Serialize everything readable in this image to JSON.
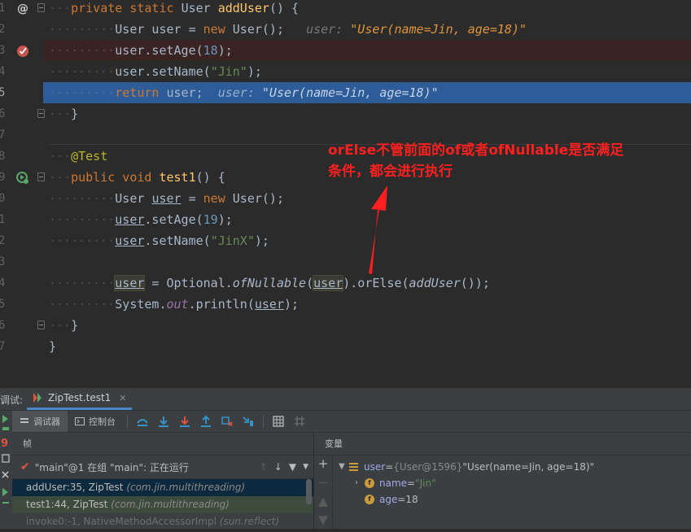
{
  "editor": {
    "lines": [
      {
        "num": "1",
        "gutter": "override-at-icon",
        "fold": true
      },
      {
        "num": "2"
      },
      {
        "num": "3",
        "gutter": "breakpoint-check-icon"
      },
      {
        "num": "4"
      },
      {
        "num": "5",
        "current": true
      },
      {
        "num": "6",
        "fold": true
      },
      {
        "num": "7"
      },
      {
        "num": "8"
      },
      {
        "num": "9",
        "gutter": "run-test-icon",
        "fold": true
      },
      {
        "num": "0"
      },
      {
        "num": "1"
      },
      {
        "num": "2"
      },
      {
        "num": "3"
      },
      {
        "num": "4"
      },
      {
        "num": "5"
      },
      {
        "num": "6",
        "fold": true
      },
      {
        "num": "7"
      }
    ],
    "code": {
      "l1_kw": "private static ",
      "l1_type": "User ",
      "l1_method": "addUser",
      "l1_rest": "() {",
      "l2_a": "User user = ",
      "l2_new": "new ",
      "l2_b": "User();",
      "l2_hint_label": "user: ",
      "l2_hint_value": "\"User(name=Jin, age=18)\"",
      "l3_a": "user.setAge(",
      "l3_num": "18",
      "l3_b": ");",
      "l4_a": "user.setName(",
      "l4_str": "\"Jin\"",
      "l4_b": ");",
      "l5_kw": "return ",
      "l5_a": "user;",
      "l5_hint_label": "user: ",
      "l5_hint_value": "\"User(name=Jin, age=18)\"",
      "l6": "}",
      "l8_ann": "@Test",
      "l9_kw": "public void ",
      "l9_method": "test1",
      "l9_rest": "() {",
      "l10_a": "User ",
      "l10_var": "user",
      "l10_b": " = ",
      "l10_new": "new ",
      "l10_c": "User();",
      "l11_var": "user",
      "l11_a": ".setAge(",
      "l11_num": "19",
      "l11_b": ");",
      "l12_var": "user",
      "l12_a": ".setName(",
      "l12_str": "\"JinX\"",
      "l12_b": ");",
      "l14_var": "user",
      "l14_a": " = Optional.",
      "l14_it": "ofNullable",
      "l14_p": "(",
      "l14_arg": "user",
      "l14_b": ").orElse(",
      "l14_it2": "addUser",
      "l14_c": "());",
      "l15_a": "System.",
      "l15_field": "out",
      "l15_b": ".println(",
      "l15_var": "user",
      "l15_c": ");",
      "l16": "}",
      "l17": "}"
    }
  },
  "annotation": {
    "line1": "orElse不管前面的of或者ofNullable是否满足",
    "line2": "条件，都会进行执行",
    "color": "#ff1f1f"
  },
  "debug": {
    "title": "调试:",
    "run_tab": "ZipTest.test1",
    "tabs": {
      "debugger": "调试器",
      "console": "控制台"
    },
    "frames_header": "帧",
    "variables_header": "变量",
    "thread": "\"main\"@1 在组 \"main\": 正在运行",
    "frames": [
      {
        "method": "addUser:35, ZipTest",
        "pkg": "(com.jin.multithreading)"
      },
      {
        "method": "test1:44, ZipTest",
        "pkg": "(com.jin.multithreading)"
      },
      {
        "method": "invoke0:-1, NativeMethodAccessorImpl",
        "pkg": "(sun.reflect)"
      }
    ],
    "variables": {
      "user_name": "user",
      "user_eq": " = ",
      "user_ref": "{User@1596}",
      "user_value": " \"User(name=Jin, age=18)\"",
      "name_name": "name",
      "name_eq": " = ",
      "name_value": "\"Jin\"",
      "age_name": "age",
      "age_eq": " = ",
      "age_value": "18"
    }
  }
}
